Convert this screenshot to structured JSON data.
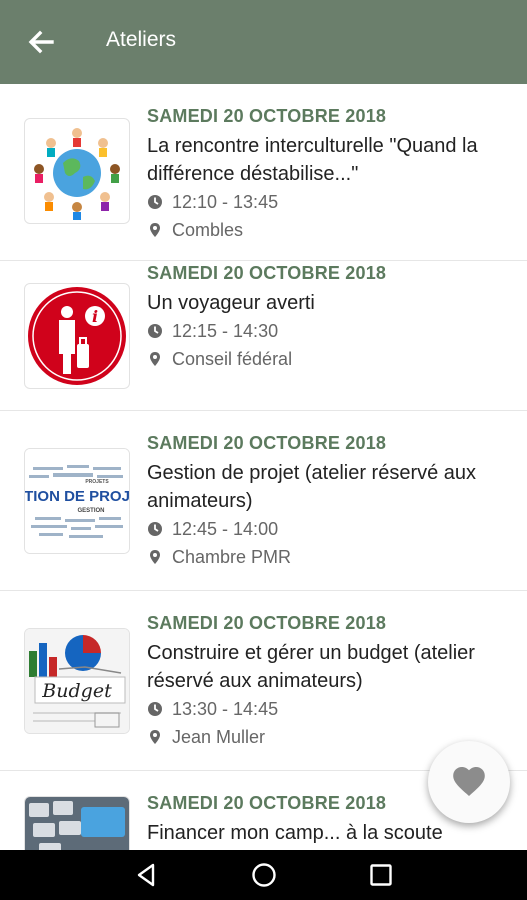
{
  "appbar": {
    "title": "Ateliers",
    "back_icon": "arrow-left-icon",
    "background": "#6b7f6c"
  },
  "workshops": [
    {
      "date": "SAMEDI 20 OCTOBRE 2018",
      "title": "La rencontre interculturelle \"Quand la différence déstabilise...\"",
      "time": "12:10 - 13:45",
      "location": "Combles",
      "image": "children-globe-image"
    },
    {
      "date": "SAMEDI 20 OCTOBRE 2018",
      "title": "Un voyageur averti",
      "time": "12:15 - 14:30",
      "location": "Conseil fédéral",
      "image": "traveler-info-sign-image"
    },
    {
      "date": "SAMEDI 20 OCTOBRE 2018",
      "title": "Gestion de projet (atelier réservé aux animateurs)",
      "time": "12:45 - 14:00",
      "location": "Chambre PMR",
      "image": "gestion-de-projet-wordcloud-image",
      "image_text": "STION DE PROJE"
    },
    {
      "date": "SAMEDI 20 OCTOBRE 2018",
      "title": "Construire et gérer un budget (atelier réservé aux animateurs)",
      "time": "13:30 - 14:45",
      "location": "Jean Muller",
      "image": "budget-chart-image",
      "image_text": "Budget"
    },
    {
      "date": "SAMEDI 20 OCTOBRE 2018",
      "title": "Financer mon camp... à la scoute",
      "time": "",
      "location": "",
      "image": "keyboard-image"
    }
  ],
  "icons": {
    "time": "clock-icon",
    "location": "location-pin-icon",
    "favorite": "heart-icon"
  },
  "colors": {
    "accent": "#5c7a5e",
    "fab_heart": "#8c8c8c"
  },
  "navbar": {
    "back": "nav-back-icon",
    "home": "nav-home-icon",
    "recents": "nav-recents-icon"
  }
}
